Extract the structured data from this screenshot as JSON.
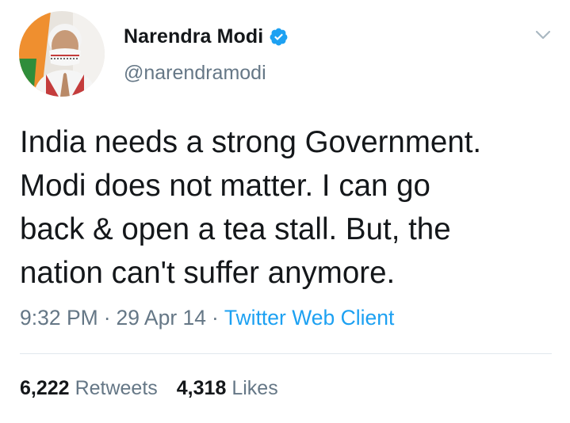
{
  "user": {
    "display_name": "Narendra Modi",
    "handle": "@narendramodi",
    "verified": true,
    "avatar_icon": "profile-photo"
  },
  "tweet": {
    "text": "India needs a strong Government.\nModi does not matter. I can go\nback & open a tea stall. But, the\nnation can't suffer anymore.",
    "time": "9:32 PM",
    "separator": "·",
    "date": "29 Apr 14",
    "source": "Twitter Web Client"
  },
  "stats": {
    "retweets_count": "6,222",
    "retweets_label": "Retweets",
    "likes_count": "4,318",
    "likes_label": "Likes"
  },
  "colors": {
    "text": "#14171a",
    "secondary": "#657786",
    "accent": "#1da1f2",
    "divider": "#e1e8ed"
  },
  "icons": {
    "verified": "verified-badge-icon",
    "menu": "chevron-down-icon"
  }
}
